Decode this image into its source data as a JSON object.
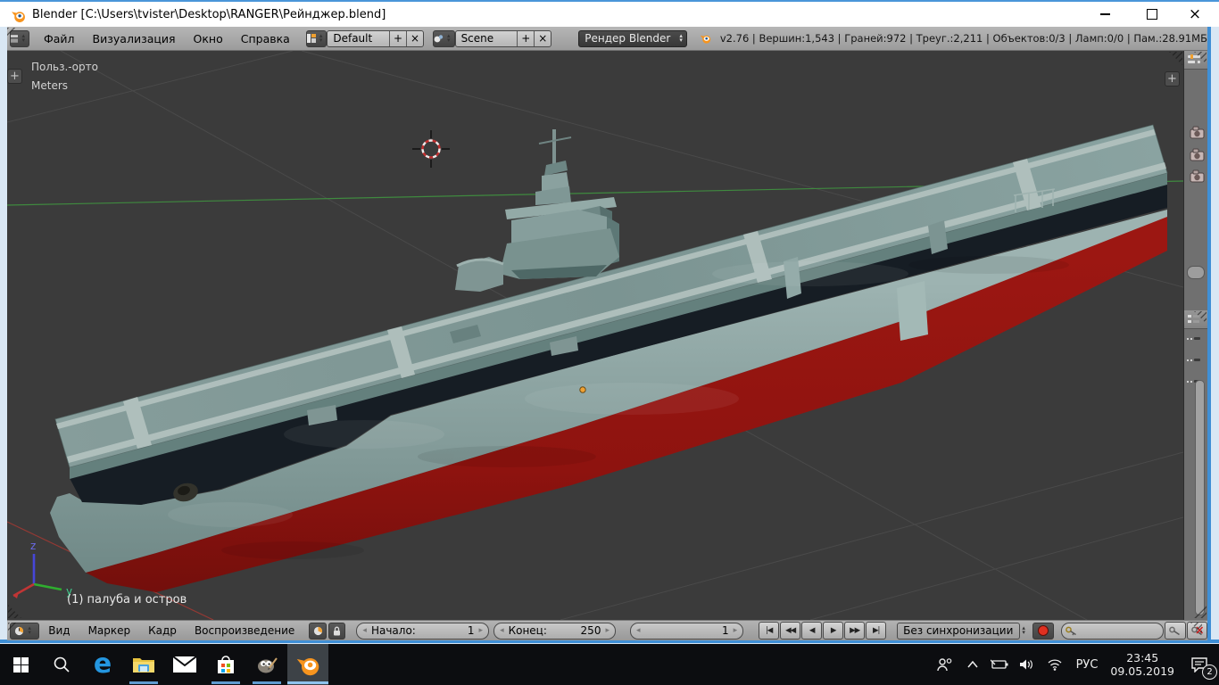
{
  "window": {
    "title": "Blender [C:\\Users\\tvister\\Desktop\\RANGER\\Рейнджер.blend]"
  },
  "menubar": {
    "menus": [
      "Файл",
      "Визуализация",
      "Окно",
      "Справка"
    ],
    "layout_value": "Default",
    "scene_value": "Scene",
    "engine_value": "Рендер Blender",
    "stats": "v2.76 | Вершин:1,543 | Граней:972 | Треуг.:2,211 | Объектов:0/3 | Ламп:0/0 | Пам.:28.91МБ"
  },
  "viewport": {
    "view_label": "Польз.-орто",
    "unit_label": "Meters",
    "active_object": "(1) палуба и остров",
    "axis": {
      "z": "z",
      "y": "y"
    }
  },
  "timeline": {
    "menus": [
      "Вид",
      "Маркер",
      "Кадр",
      "Воспроизведение"
    ],
    "start_label": "Начало:",
    "start_value": "1",
    "end_label": "Конец:",
    "end_value": "250",
    "frame_value": "1",
    "sync_mode": "Без синхронизации",
    "playback": [
      "|◀",
      "◀◀",
      "◀",
      "▶",
      "▶▶",
      "▶|"
    ]
  },
  "taskbar": {
    "tray": {
      "lang": "РУС",
      "time": "23:45",
      "date": "09.05.2019",
      "badge": "2"
    }
  },
  "icons": {
    "add": "+",
    "x": "×",
    "up": "▴",
    "down": "▾",
    "left": "◂",
    "right": "▸",
    "blender_logo": "orange-disc-with-white-center",
    "editor_selector": "up-down-arrows",
    "screen_layout": "grid",
    "scene_browse": "sphere",
    "clock": "clock-face",
    "lock": "padlock",
    "record": "red-circle",
    "key": "keying-key",
    "key_delete": "key-with-red-x",
    "start": "windows-grid",
    "search": "magnifier",
    "edge": "letter-e",
    "explorer": "folder",
    "mail": "envelope",
    "store": "shopping-bag",
    "gimp": "wilber",
    "blender": "blender-logo",
    "people": "two-persons",
    "chevron_up": "chevron",
    "battery": "battery-plug",
    "speaker": "speaker-waves",
    "wifi": "wifi-arcs",
    "action_center": "comment-bubble",
    "minimize": "line",
    "maximize": "square",
    "close": "x"
  },
  "colors": {
    "accent_blue": "#3f8fd6",
    "header_bg": "#a8a8a8",
    "viewport_bg": "#3b3b3b",
    "deck": "#7d9593",
    "deck_stripe": "#b4c3c0",
    "hull_red": "#8e1510",
    "taskbar_bg": "#0c0d10",
    "underline_blue": "#5f9bd0"
  }
}
